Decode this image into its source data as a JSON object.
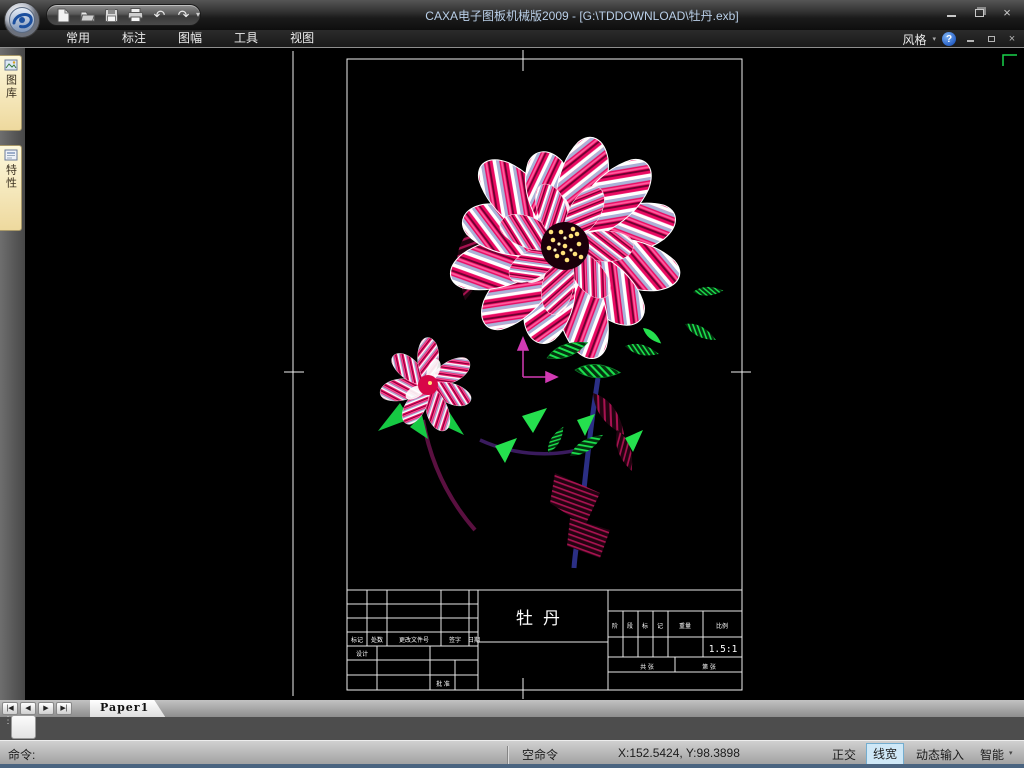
{
  "window": {
    "title": "CAXA电子图板机械版2009 - [G:\\TDDOWNLOAD\\牡丹.exb]",
    "close_glyph": "×"
  },
  "quick_access": {
    "icons": [
      "new-file",
      "open-file",
      "save",
      "print",
      "undo",
      "redo"
    ],
    "undo_glyph": "↶",
    "redo_glyph": "↷",
    "caret_glyph": "▾"
  },
  "menu": {
    "items": [
      {
        "label": "常用"
      },
      {
        "label": "标注"
      },
      {
        "label": "图幅"
      },
      {
        "label": "工具"
      },
      {
        "label": "视图"
      }
    ],
    "style_label": "风格",
    "style_caret": "▾",
    "help_glyph": "?"
  },
  "sidebar": {
    "tabs": [
      {
        "label": "图库"
      },
      {
        "label": "特性"
      }
    ]
  },
  "drawing": {
    "file_name": "牡丹.exb",
    "title_block": {
      "title": "牡丹",
      "scale_value": "1.5:1",
      "rev_headers": [
        "标记",
        "处数",
        "更改文件号",
        "签字",
        "日期"
      ],
      "designer_label": "设计",
      "approve_label": "批 准",
      "stage_chars": [
        "阶",
        "段",
        "标",
        "记"
      ],
      "weight_label": "重量",
      "scale_label": "比例",
      "sheet_total_label": "共 张",
      "sheet_no_label": "第 张"
    }
  },
  "sheet_tabs": {
    "active": "Paper1",
    "nav": [
      {
        "name": "first-sheet",
        "glyph": "|◀"
      },
      {
        "name": "prev-sheet",
        "glyph": "◀"
      },
      {
        "name": "next-sheet",
        "glyph": "▶"
      },
      {
        "name": "last-sheet",
        "glyph": "▶|"
      }
    ]
  },
  "status_bar": {
    "prompt": "命令:",
    "state": "空命令",
    "coordinates": "X:152.5424, Y:98.3898",
    "toggles": [
      {
        "label": "正交",
        "active": false
      },
      {
        "label": "线宽",
        "active": true
      },
      {
        "label": "动态输入",
        "active": false
      },
      {
        "label": "智能",
        "active": false
      }
    ],
    "caret_glyph": "▾",
    "grip_glyph": "⋮"
  },
  "colors": {
    "title_text": "#b9cfe8",
    "petal_pink": "#ea0a62",
    "petal_periwinkle": "#a9b2d8",
    "leaf_green": "#1be14d",
    "stamen_yellow": "#ffe27a",
    "axis_magenta": "#d23ab4",
    "active_toggle_bg": "#cfe8f7",
    "sidebar_tab_bg": "#f5ecc4"
  }
}
